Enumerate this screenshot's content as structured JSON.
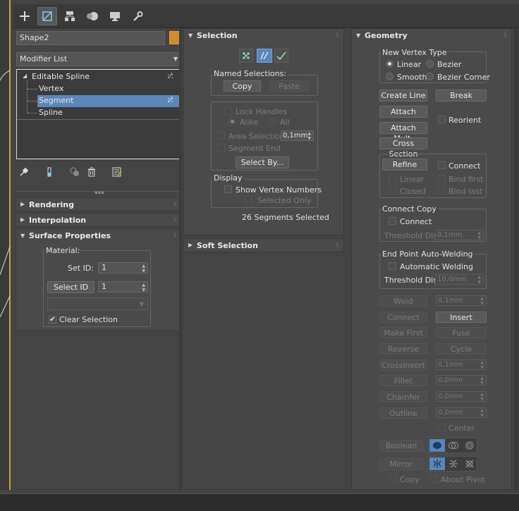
{
  "object": {
    "name": "Shape2",
    "color": "#d48a30"
  },
  "modifier_list": {
    "label": "Modifier List"
  },
  "stack": {
    "root": "Editable Spline",
    "items": [
      "Vertex",
      "Segment",
      "Spline"
    ],
    "selected": "Segment"
  },
  "collapsed_rollouts": [
    "Rendering",
    "Interpolation"
  ],
  "surface_properties": {
    "title": "Surface Properties",
    "material_label": "Material:",
    "set_id_label": "Set ID:",
    "set_id_value": "1",
    "select_id_button": "Select ID",
    "select_id_value": "1",
    "clear_selection": "Clear Selection"
  },
  "selection": {
    "title": "Selection",
    "named_selections": "Named Selections:",
    "copy": "Copy",
    "paste": "Paste",
    "lock_handles": "Lock Handles",
    "alike": "Alike",
    "all": "All",
    "area_selection": "Area Selection",
    "area_value": "0,1mm",
    "segment_end": "Segment End",
    "select_by": "Select By...",
    "display": "Display",
    "show_vertex_numbers": "Show Vertex Numbers",
    "selected_only": "Selected Only",
    "status": "26 Segments Selected"
  },
  "soft_selection": {
    "title": "Soft Selection"
  },
  "geometry": {
    "title": "Geometry",
    "new_vertex_type": "New Vertex Type",
    "linear": "Linear",
    "bezier": "Bezier",
    "smooth": "Smooth",
    "bezier_corner": "Bezier Corner",
    "create_line": "Create Line",
    "break": "Break",
    "attach": "Attach",
    "reorient": "Reorient",
    "attach_mult": "Attach Mult.",
    "cross_section": "Cross Section",
    "refine": "Refine",
    "connect": "Connect",
    "refine_linear": "Linear",
    "bind_first": "Bind first",
    "closed": "Closed",
    "bind_last": "Bind last",
    "connect_copy": "Connect Copy",
    "cc_connect": "Connect",
    "threshold_dist": "Threshold Dist",
    "cc_threshold_value": "0,1mm",
    "end_point_auto_welding": "End Point Auto-Welding",
    "automatic_welding": "Automatic Welding",
    "ep_threshold_value": "10,0mm",
    "weld": "Weld",
    "weld_value": "0,1mm",
    "connect_btn": "Connect",
    "insert": "Insert",
    "make_first": "Make First",
    "fuse": "Fuse",
    "reverse": "Reverse",
    "cycle": "Cycle",
    "crossinsert": "CrossInsert",
    "crossinsert_value": "0,1mm",
    "fillet": "Fillet",
    "fillet_value": "0,0mm",
    "chamfer": "Chamfer",
    "chamfer_value": "0,0mm",
    "outline": "Outline",
    "outline_value": "0,0mm",
    "center": "Center",
    "boolean": "Boolean",
    "mirror": "Mirror",
    "copy": "Copy",
    "about_pivot": "About Pivot"
  },
  "colors": {
    "panel": "#4a4a4a",
    "accent_selected": "#5b86b8",
    "object_swatch": "#d48a30",
    "viewport_border": "#c8a82c"
  }
}
